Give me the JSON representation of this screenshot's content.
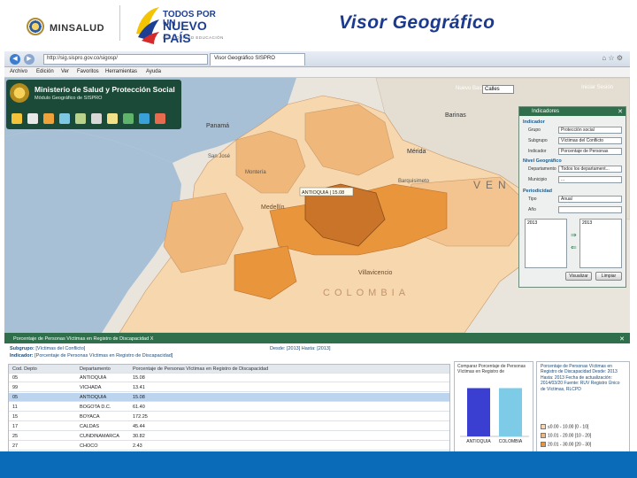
{
  "header": {
    "minsalud": "MINSALUD",
    "logo_line1": "TODOS POR UN",
    "logo_line2": "NUEVO PAÍS",
    "logo_tagline": "PAZ   EQUIDAD   EDUCACIÓN",
    "title": "Visor Geográfico"
  },
  "browser": {
    "address": "http://sig.sispro.gov.co/sigosp/",
    "tab_label": "Visor Geográfico SISPRO",
    "menu": [
      "Archivo",
      "Edición",
      "Ver",
      "Favoritos",
      "Herramientas",
      "Ayuda"
    ]
  },
  "banner": {
    "title": "Ministerio de Salud y Protección Social",
    "subtitle": "Módulo Geográfico de SISPRO",
    "nuevo_label": "Nuevo Base",
    "nuevo_value": "Calles",
    "iniciar": "Iniciar Sesión"
  },
  "map": {
    "labels": [
      "Panamá",
      "Barinas",
      "Mérida",
      "Barquisimeto",
      "VEN",
      "COLOMBIA",
      "Medellín",
      "Villavicencio",
      "San José",
      "Montería"
    ],
    "tooltip": "ANTIOQUIA  |  15.08",
    "colors": {
      "light": "#f6d7ae",
      "mid": "#f0b77a",
      "strong": "#e8953c",
      "dark": "#c97429",
      "sea": "#9fb8cf"
    }
  },
  "indicadores": {
    "header": "Indicadores",
    "section_indicator": "Indicador",
    "fields": [
      {
        "label": "Grupo",
        "value": "Protección social"
      },
      {
        "label": "Subgrupo",
        "value": "Víctimas del Conflicto"
      },
      {
        "label": "Indicador",
        "value": "Porcentaje de Personas"
      }
    ],
    "section_geo": "Nivel Geográfico",
    "geo_fields": [
      {
        "label": "Departamento",
        "value": "Todos los departament..."
      },
      {
        "label": "Municipio",
        "value": "..."
      }
    ],
    "section_period": "Periodicidad",
    "period_fields": [
      {
        "label": "Tipo",
        "value": "Anual"
      },
      {
        "label": "Año",
        "value": ""
      }
    ],
    "years_left": [
      "2013"
    ],
    "years_right": [
      "2013"
    ],
    "btn_visualizar": "Visualizar",
    "btn_limpiar": "Limpiar"
  },
  "table": {
    "panel_title": "Porcentaje de Personas Víctimas en Registro de Discapacidad  X",
    "subgrupo_label": "Subgrupo:",
    "subgrupo_value": "[Víctimas del Conflicto]",
    "indicador_label": "Indicador:",
    "indicador_value": "[Porcentaje de Personas Víctimas en Registro de Discapacidad]",
    "desde": "Desde: [2013]  Hasta: [2013]",
    "columns": [
      "Cod. Depto",
      "Departamento",
      "Porcentaje de Personas Víctimas en Registro de Discapacidad"
    ],
    "rows": [
      [
        "05",
        "ANTIOQUIA",
        "15.08"
      ],
      [
        "99",
        "VICHADA",
        "13.41"
      ],
      [
        "05",
        "ANTIOQUIA",
        "15.08"
      ],
      [
        "11",
        "BOGOTA D.C.",
        "61.40"
      ],
      [
        "15",
        "BOYACA",
        "172.25"
      ],
      [
        "17",
        "CALDAS",
        "45.44"
      ],
      [
        "25",
        "CUNDINAMARCA",
        "30.82"
      ],
      [
        "27",
        "CHOCO",
        "2.43"
      ]
    ],
    "selected_row": 2
  },
  "compare_chart": {
    "title": "Comparar Porcentaje de Personas Víctimas en Registro de",
    "categories": [
      "ANTIOQUIA",
      "COLOMBIA"
    ],
    "values": [
      15.08,
      15.08
    ],
    "colors": [
      "#3b3fd1",
      "#7ecbe8"
    ]
  },
  "legend_panel": {
    "text": "Porcentaje de Personas Víctimas en Registro de Discapacidad Desde: 2013 Hasta: 2013 Fecha de actualización: 2014/03/20 Fuente: RUV Registro Único de Víctimas, RLCPD",
    "ranges": [
      {
        "label": "≤0.00 - 10.00  [0 - 10]",
        "color": "#f6d7ae"
      },
      {
        "label": "10.01 - 20.00  [10 - 20]",
        "color": "#f0b77a"
      },
      {
        "label": "20.01 - 30.00  [20 - 30]",
        "color": "#e8953c"
      }
    ]
  }
}
